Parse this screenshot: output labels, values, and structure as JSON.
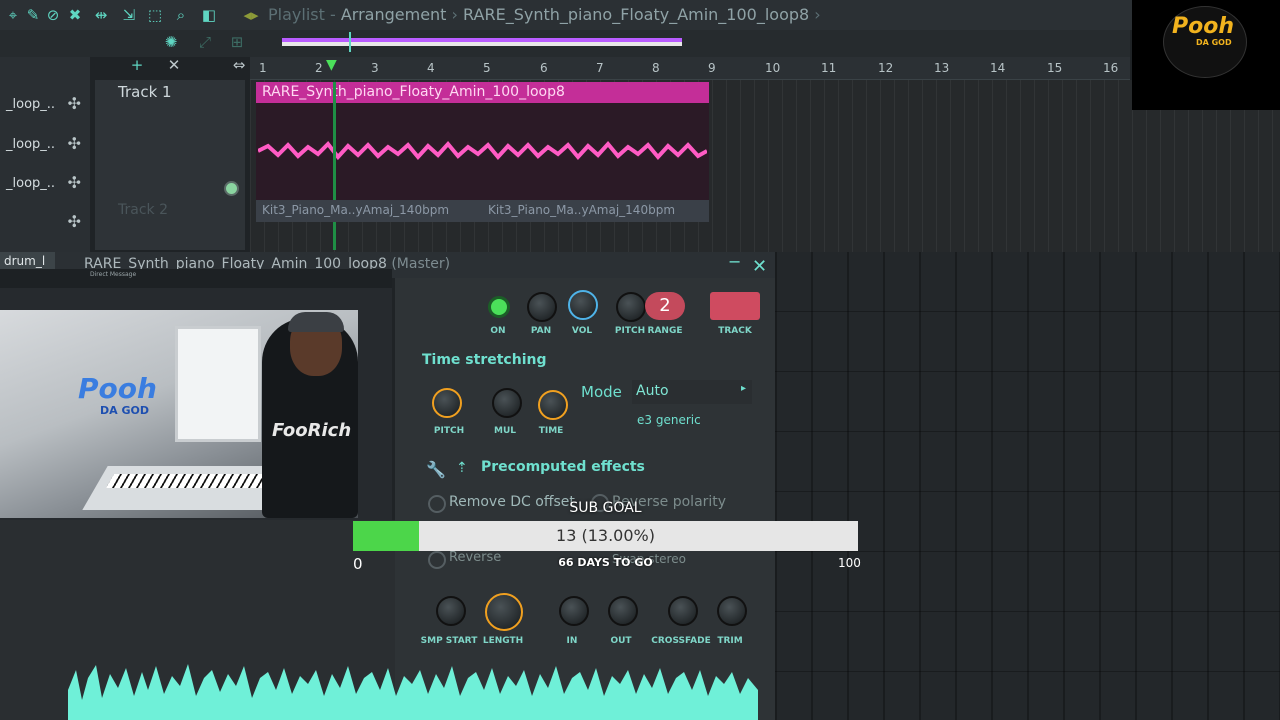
{
  "toolbar": {
    "breadcrumb_root": "Playlist",
    "breadcrumb_sep1": "-",
    "breadcrumb_view": "Arrangement",
    "breadcrumb_sep2": "›",
    "pattern_name": "RARE_Synth_piano_Floaty_Amin_100_loop8",
    "breadcrumb_end": "›",
    "icons": [
      "snap-icon",
      "draw-icon",
      "paint-icon",
      "delete-icon",
      "mute-icon",
      "slip-icon",
      "select-icon",
      "zoom-icon",
      "playback-icon"
    ]
  },
  "ruler": {
    "bars": [
      "1",
      "2",
      "3",
      "4",
      "5",
      "6",
      "7",
      "8",
      "9",
      "10",
      "11",
      "12",
      "13",
      "14",
      "15",
      "16"
    ]
  },
  "left_panel": {
    "items": [
      {
        "label": "_loop_.."
      },
      {
        "label": "_loop_.."
      },
      {
        "label": "_loop_.."
      },
      {
        "label": ""
      }
    ],
    "tab_label": "drum_l"
  },
  "tracks": [
    {
      "name": "Track 1"
    },
    {
      "name": "Track 2"
    }
  ],
  "clips": {
    "main_clip_title": "RARE_Synth_piano_Floaty_Amin_100_loop8",
    "sub_clip_a": "Kit3_Piano_Ma..yAmaj_140bpm",
    "sub_clip_b": "Kit3_Piano_Ma..yAmaj_140bpm"
  },
  "plugin": {
    "title": "RARE_Synth_piano_Floaty_Amin_100_loop8",
    "title_suffix": "(Master)",
    "top_labels": [
      "ON",
      "PAN",
      "VOL",
      "PITCH",
      "RANGE",
      "TRACK"
    ],
    "range_value": "2",
    "time_stretching": "Time stretching",
    "ts_labels": [
      "PITCH",
      "MUL",
      "TIME"
    ],
    "mode_label": "Mode",
    "mode_value": "Auto",
    "mode_sub": "e3 generic",
    "precomputed": "Precomputed effects",
    "remove_dc": "Remove DC offset",
    "reverse_polarity": "Reverse polarity",
    "reverse": "Reverse",
    "swap_stereo": "Swap stereo",
    "bottom_labels": [
      "SMP START",
      "LENGTH",
      "IN",
      "OUT",
      "CROSSFADE",
      "TRIM"
    ]
  },
  "webcam": {
    "bar_label": "Direct Message",
    "logo_text": "Pooh",
    "logo_sub": "DA GOD",
    "shirt_text": "FooRich"
  },
  "sub_goal": {
    "title": "SUB GOAL",
    "value_text": "13 (13.00%)",
    "progress_fraction": 0.13,
    "days_left": "66 DAYS TO GO",
    "min": "0",
    "max": "100"
  },
  "badge": {
    "text": "Pooh",
    "sub": "DA GOD"
  },
  "colors": {
    "accent": "#5fd6c2",
    "clip": "#c42e98",
    "goal_fill": "#4cd64a",
    "waveform": "#6ff0d8"
  }
}
